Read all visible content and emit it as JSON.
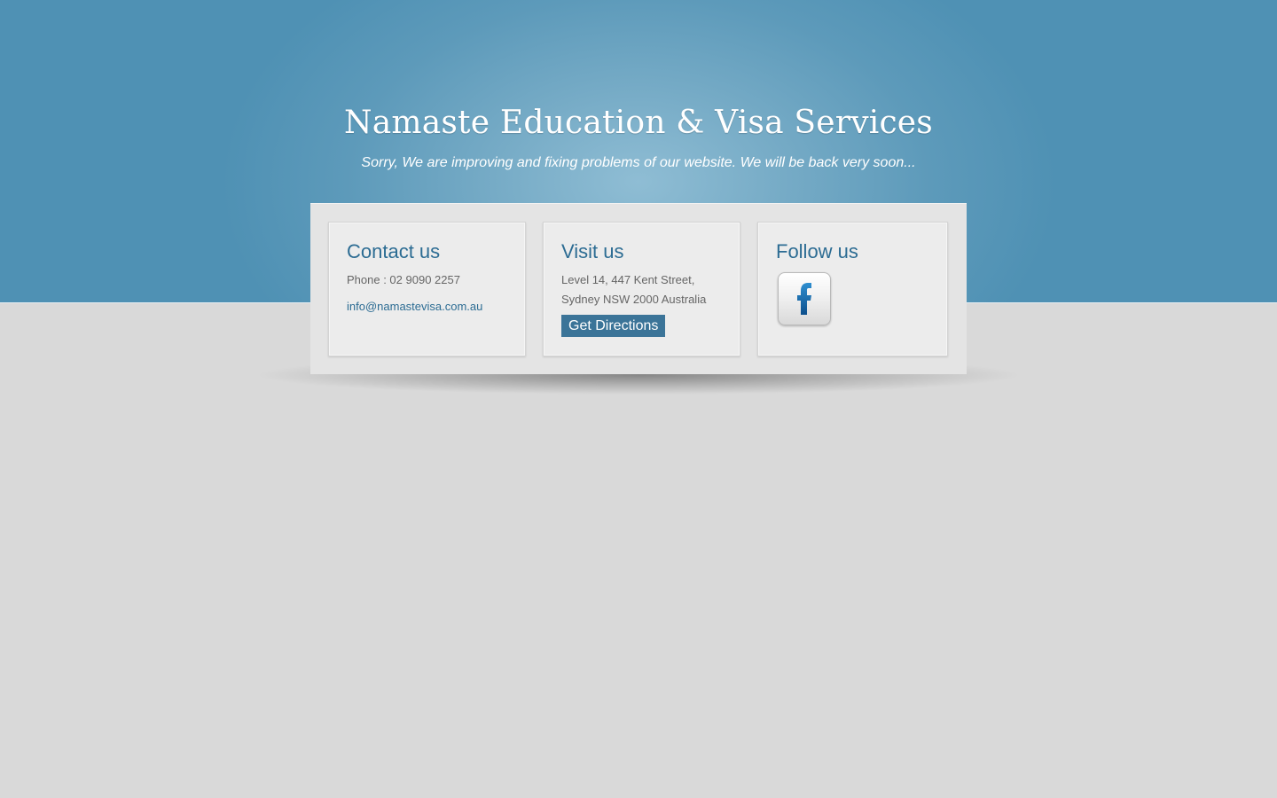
{
  "header": {
    "title": "Namaste Education & Visa Services",
    "subtitle": "Sorry, We are improving and fixing problems of our website. We will be back very soon..."
  },
  "contact": {
    "heading": "Contact us",
    "phone": "Phone : 02 9090 2257",
    "email": "info@namastevisa.com.au"
  },
  "visit": {
    "heading": "Visit us",
    "address_line1": "Level 14, 447 Kent Street,",
    "address_line2": "Sydney NSW 2000 Australia",
    "directions_label": "Get Directions"
  },
  "follow": {
    "heading": "Follow us",
    "icon": "facebook-icon"
  },
  "colors": {
    "hero_blue": "#4f91b4",
    "heading_blue": "#2c6c93",
    "button_blue": "#3b7498",
    "page_gray": "#d9d9d9"
  }
}
